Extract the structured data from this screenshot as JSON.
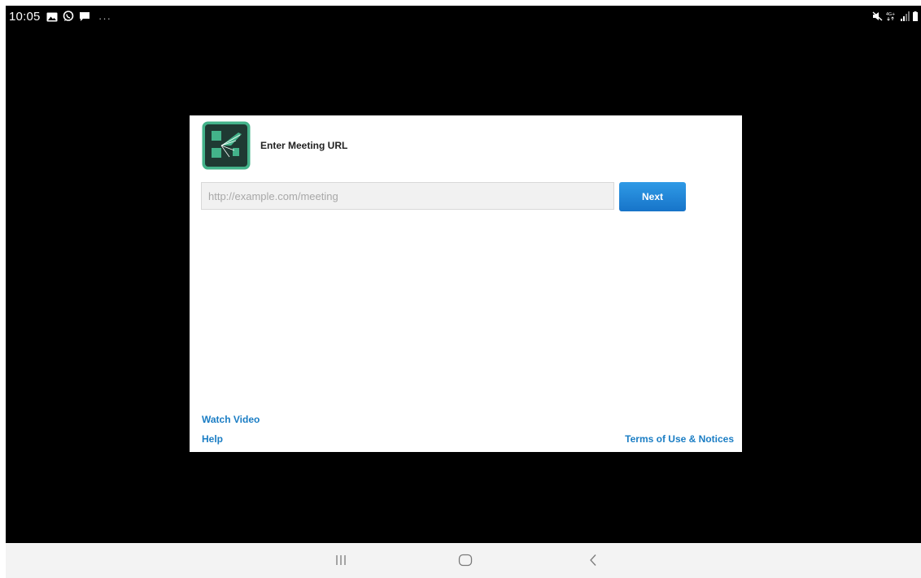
{
  "status_bar": {
    "time": "10:05",
    "left_icons": [
      "gallery-icon",
      "whatsapp-icon",
      "message-icon"
    ],
    "more": "···",
    "right_icons": [
      "mute-icon",
      "4g-icon",
      "signal-icon",
      "battery-icon"
    ]
  },
  "dialog": {
    "title": "Enter Meeting URL",
    "url_input": {
      "value": "",
      "placeholder": "http://example.com/meeting"
    },
    "next_label": "Next",
    "watch_video_label": "Watch Video",
    "help_label": "Help",
    "terms_label": "Terms of Use & Notices"
  },
  "nav_bar": {
    "buttons": [
      "recents-icon",
      "home-icon",
      "back-icon"
    ]
  },
  "colors": {
    "screen_background": "#000000",
    "dialog_background": "#ffffff",
    "accent_blue": "#1a7dc4",
    "button_blue": "#1e88d8",
    "logo_dark": "#1f3a33",
    "logo_green": "#43b38a"
  }
}
